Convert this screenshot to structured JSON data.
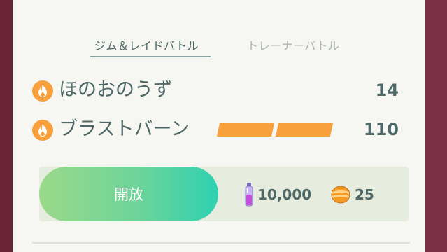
{
  "tabs": [
    {
      "label": "ジム＆レイドバトル",
      "active": true
    },
    {
      "label": "トレーナーバトル",
      "active": false
    }
  ],
  "moves": [
    {
      "name": "ほのおのうず",
      "power": "14",
      "type_icon": "fire-type-icon",
      "energy_bars": 0
    },
    {
      "name": "ブラストバーン",
      "power": "110",
      "type_icon": "fire-type-icon",
      "energy_bars": 2
    }
  ],
  "unlock": {
    "button_label": "開放",
    "stardust_cost": "10,000",
    "candy_cost": "25",
    "stardust_icon": "stardust-icon",
    "candy_icon": "candy-icon"
  },
  "colors": {
    "fire": "#f7a03c",
    "text": "#4e6867",
    "button_start": "#9bd98a",
    "button_end": "#2fd1b1"
  }
}
